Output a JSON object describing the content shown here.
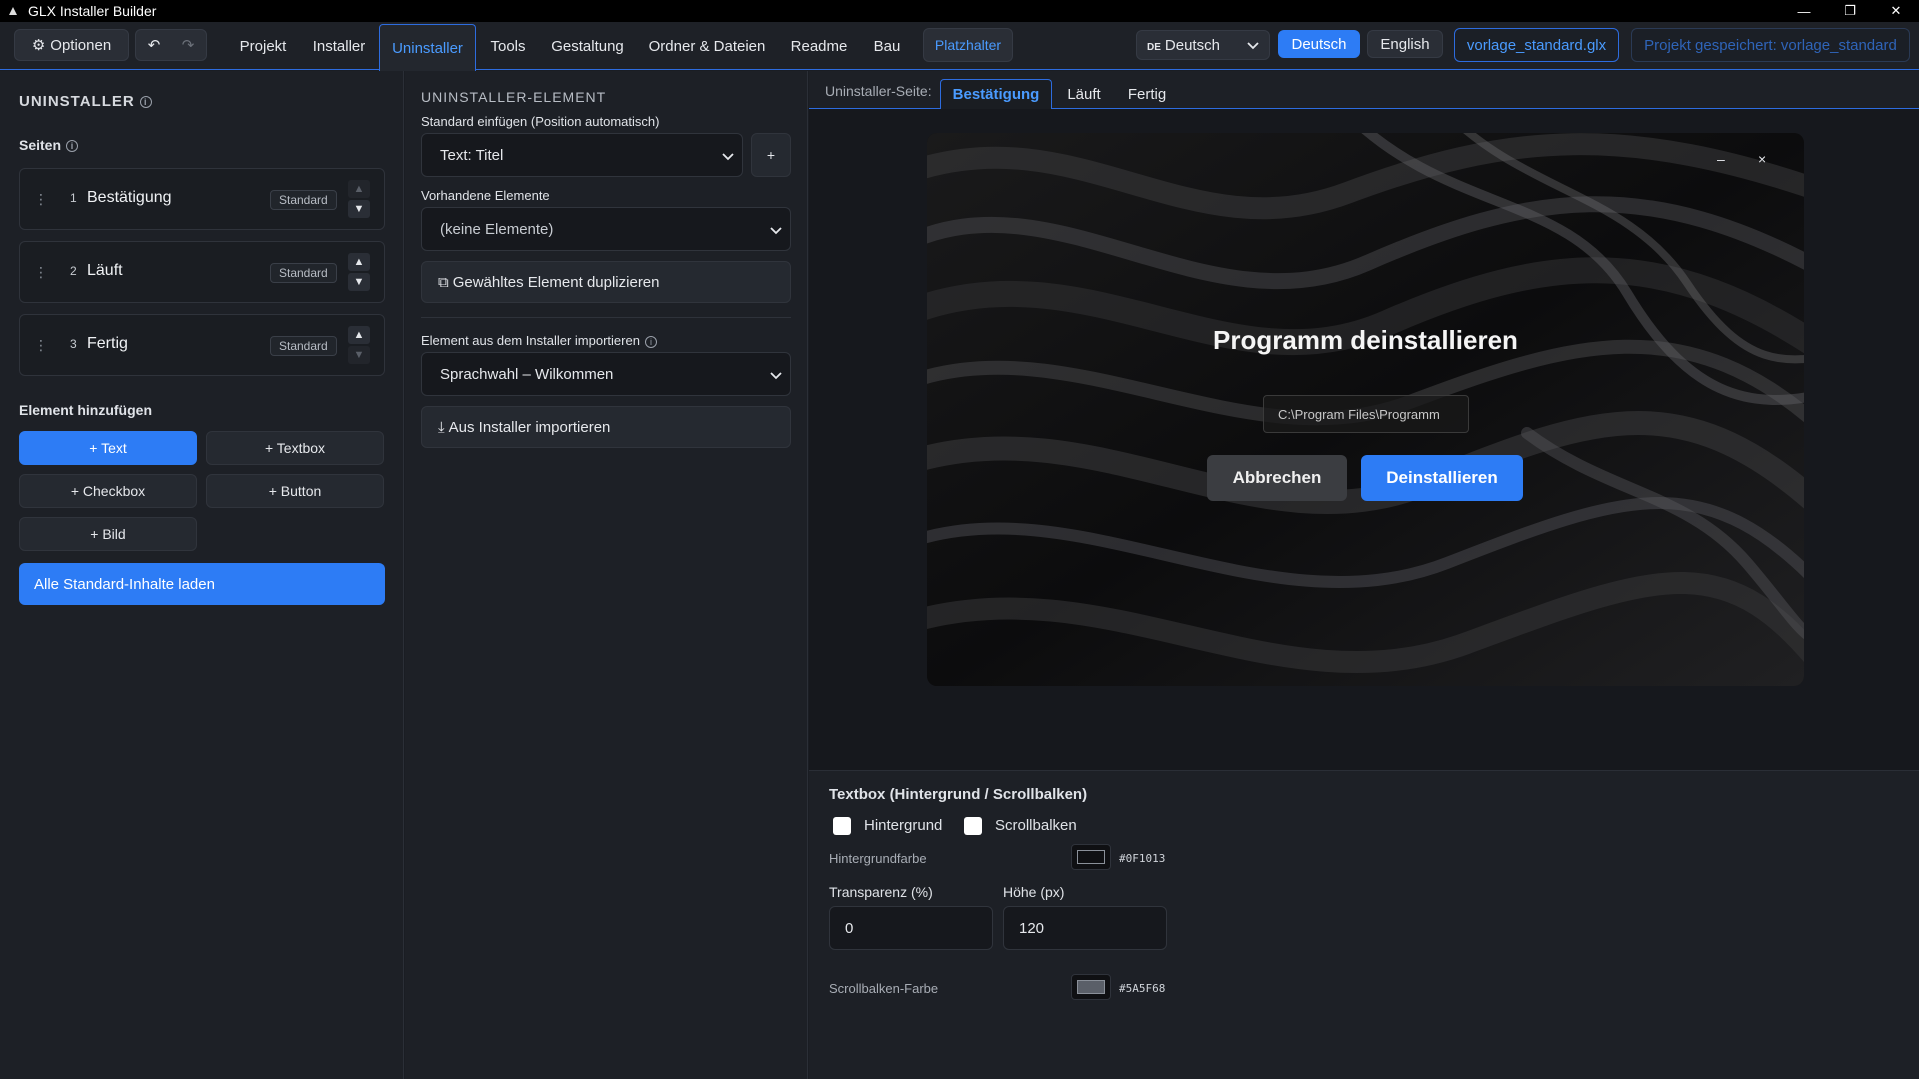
{
  "window": {
    "title": "GLX Installer Builder"
  },
  "toolbar": {
    "options_label": "Optionen",
    "tabs": [
      "Projekt",
      "Installer",
      "Uninstaller",
      "Tools",
      "Gestaltung",
      "Ordner & Dateien",
      "Readme",
      "Bau"
    ],
    "active_tab": "Uninstaller",
    "placeholder_label": "Platzhalter",
    "language_select": {
      "flag": "DE",
      "value": "Deutsch"
    },
    "lang_deutsch": "Deutsch",
    "lang_english": "English",
    "file_name": "vorlage_standard.glx",
    "saved_status": "Projekt gespeichert: vorlage_standard"
  },
  "left": {
    "section_title": "UNINSTALLER",
    "pages_label": "Seiten",
    "pages": [
      {
        "num": "1",
        "name": "Bestätigung",
        "badge": "Standard"
      },
      {
        "num": "2",
        "name": "Läuft",
        "badge": "Standard"
      },
      {
        "num": "3",
        "name": "Fertig",
        "badge": "Standard"
      }
    ],
    "add_element_label": "Element hinzufügen",
    "add_buttons": [
      "+ Text",
      "+ Textbox",
      "+ Checkbox",
      "+ Button",
      "+ Bild"
    ],
    "load_all_label": "Alle Standard-Inhalte laden"
  },
  "middle": {
    "section_title": "UNINSTALLER-ELEMENT",
    "insert_default_label": "Standard einfügen (Position automatisch)",
    "insert_default_value": "Text: Titel",
    "plus_label": "+",
    "existing_label": "Vorhandene Elemente",
    "existing_value": "(keine Elemente)",
    "duplicate_label": "Gewähltes Element duplizieren",
    "import_label": "Element aus dem Installer importieren",
    "import_value": "Sprachwahl – Wilkommen",
    "import_button": "Aus Installer importieren"
  },
  "right": {
    "subtab_label": "Uninstaller-Seite:",
    "subtabs": [
      "Bestätigung",
      "Läuft",
      "Fertig"
    ],
    "active_subtab": "Bestätigung",
    "preview": {
      "minimize": "–",
      "close": "×",
      "title": "Programm deinstallieren",
      "path": "C:\\Program Files\\Programm",
      "cancel": "Abbrechen",
      "uninstall": "Deinstallieren"
    },
    "props": {
      "title": "Textbox (Hintergrund / Scrollbalken)",
      "chk_background": "Hintergrund",
      "chk_scrollbar": "Scrollbalken",
      "bg_color_label": "Hintergrundfarbe",
      "bg_color_hex": "#0F1013",
      "transparency_label": "Transparenz (%)",
      "transparency_value": "0",
      "height_label": "Höhe (px)",
      "height_value": "120",
      "scroll_color_label": "Scrollbalken-Farbe",
      "scroll_color_hex": "#5A5F68"
    }
  },
  "colors": {
    "accent": "#2d7cf5",
    "accent_text": "#4a9bff",
    "bg": "#1a1d23"
  }
}
